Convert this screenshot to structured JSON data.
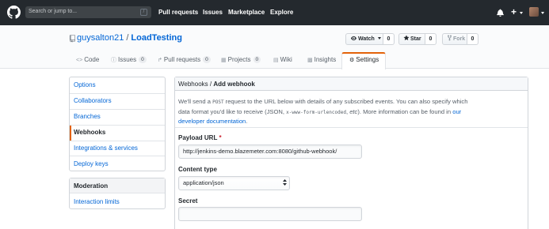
{
  "header": {
    "search_placeholder": "Search or jump to...",
    "search_shortcut": "/",
    "nav": [
      "Pull requests",
      "Issues",
      "Marketplace",
      "Explore"
    ],
    "plus_label": "+"
  },
  "repo": {
    "owner": "guysalton21",
    "separator": "/",
    "name": "LoadTesting",
    "watch_label": "Watch",
    "watch_count": "0",
    "star_label": "Star",
    "star_count": "0",
    "fork_label": "Fork",
    "fork_count": "0"
  },
  "tabs": [
    {
      "label": "Code",
      "icon": "code-icon"
    },
    {
      "label": "Issues",
      "count": "0",
      "icon": "issue-icon"
    },
    {
      "label": "Pull requests",
      "count": "0",
      "icon": "pull-request-icon"
    },
    {
      "label": "Projects",
      "count": "0",
      "icon": "project-icon"
    },
    {
      "label": "Wiki",
      "icon": "book-icon"
    },
    {
      "label": "Insights",
      "icon": "graph-icon"
    },
    {
      "label": "Settings",
      "icon": "gear-icon",
      "active": true
    }
  ],
  "sidebar": {
    "items": [
      "Options",
      "Collaborators",
      "Branches",
      "Webhooks",
      "Integrations & services",
      "Deploy keys"
    ],
    "selected": "Webhooks",
    "moderation_title": "Moderation",
    "moderation_items": [
      "Interaction limits"
    ]
  },
  "main": {
    "breadcrumb_parent": "Webhooks",
    "breadcrumb_sep": "/",
    "breadcrumb_current": "Add webhook",
    "desc_1": "We'll send a ",
    "desc_post": "POST",
    "desc_2": " request to the URL below with details of any subscribed events. You can also specify which data format you'd like to receive (JSON, ",
    "desc_form": "x-www-form-urlencoded",
    "desc_3": ", ",
    "desc_etc": "etc",
    "desc_4": "). More information can be found in ",
    "desc_link": "our developer documentation",
    "desc_5": ".",
    "payload_label": "Payload URL",
    "required_mark": "*",
    "payload_value": "http://jenkins-demo.blazemeter.com:8080/github-webhook/",
    "content_type_label": "Content type",
    "content_type_value": "application/json",
    "secret_label": "Secret",
    "secret_value": ""
  },
  "colors": {
    "header_bg": "#24292e",
    "link": "#0366d6",
    "active_tab_accent": "#e36209",
    "required": "#cb2431"
  }
}
